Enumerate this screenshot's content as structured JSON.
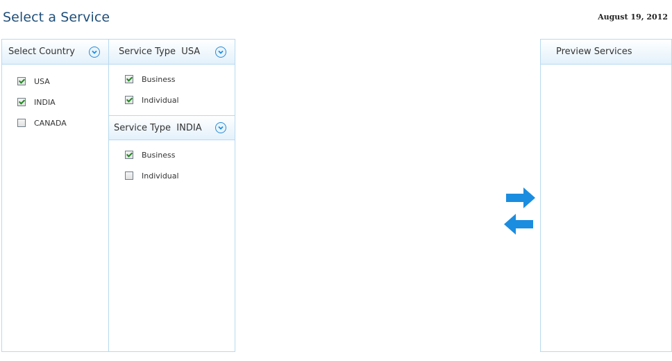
{
  "header": {
    "title": "Select a Service",
    "date": "August 19, 2012"
  },
  "country_panel": {
    "title": "Select Country",
    "items": [
      {
        "label": "USA",
        "checked": true
      },
      {
        "label": "INDIA",
        "checked": true
      },
      {
        "label": "CANADA",
        "checked": false
      }
    ]
  },
  "service_panels": [
    {
      "title": "Service Type  USA",
      "items": [
        {
          "label": "Business",
          "checked": true
        },
        {
          "label": "Individual",
          "checked": true
        }
      ]
    },
    {
      "title": "Service Type  INDIA",
      "items": [
        {
          "label": "Business",
          "checked": true
        },
        {
          "label": "Individual",
          "checked": false
        }
      ]
    }
  ],
  "preview_panel": {
    "title": "Preview Services"
  },
  "colors": {
    "accent": "#1b8de0",
    "title_text": "#1f4f7a",
    "panel_border": "#b7d9ef"
  },
  "icons": {
    "expand": "chevron-down-icon",
    "move_right": "arrow-right-icon",
    "move_left": "arrow-left-icon"
  }
}
